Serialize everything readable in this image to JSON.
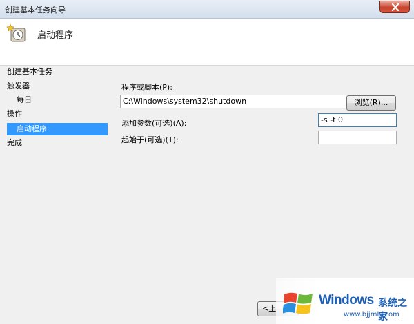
{
  "window": {
    "title": "创建基本任务向导"
  },
  "header": {
    "page_title": "启动程序"
  },
  "sidebar": {
    "items": [
      {
        "label": "创建基本任务"
      },
      {
        "label": "触发器"
      },
      {
        "label": "每日"
      },
      {
        "label": "操作"
      },
      {
        "label": "启动程序",
        "selected": true
      },
      {
        "label": "完成"
      }
    ]
  },
  "form": {
    "program_label": "程序或脚本(P):",
    "program_value": "C:\\Windows\\system32\\shutdown",
    "browse_label": "浏览(R)...",
    "args_label": "添加参数(可选)(A):",
    "args_value": "-s -t 0",
    "startin_label": "起始于(可选)(T):",
    "startin_value": ""
  },
  "footer": {
    "back_label": "<上"
  },
  "watermark": {
    "title": "Windows",
    "cn": "系统之家",
    "url": "www.bjjmlv.com"
  },
  "colors": {
    "selection": "#3399ff",
    "close": "#c7432d"
  }
}
